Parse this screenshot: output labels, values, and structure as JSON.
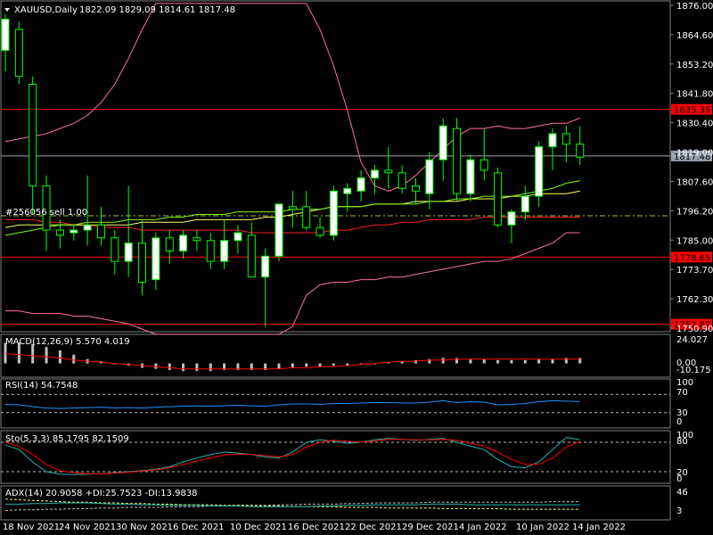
{
  "chart_data": {
    "type": "candlestick",
    "symbol_label": "XAUUSD,Daily",
    "ohlc_header": "1822.09 1829.09 1814.61 1817.48",
    "y_axis_ticks": [
      "1876.00",
      "1864.60",
      "1853.20",
      "1841.80",
      "1830.40",
      "1819.00",
      "1807.60",
      "1796.20",
      "1785.00",
      "1773.70",
      "1762.30",
      "1750.90"
    ],
    "x_axis_labels": [
      "18 Nov 2021",
      "24 Nov 2021",
      "30 Nov 2021",
      "6 Dec 2021",
      "10 Dec 2021",
      "16 Dec 2021",
      "22 Dec 2021",
      "29 Dec 2021",
      "4 Jan 2022",
      "10 Jan 2022",
      "14 Jan 2022"
    ],
    "ylim": [
      1750.0,
      1877.0
    ],
    "candles": [
      {
        "o": 1858,
        "h": 1872,
        "l": 1850,
        "c": 1870
      },
      {
        "o": 1866,
        "h": 1869,
        "l": 1845,
        "c": 1848
      },
      {
        "o": 1845,
        "h": 1848,
        "l": 1795,
        "c": 1806
      },
      {
        "o": 1806,
        "h": 1810,
        "l": 1781,
        "c": 1789
      },
      {
        "o": 1789,
        "h": 1793,
        "l": 1782,
        "c": 1787
      },
      {
        "o": 1788,
        "h": 1791,
        "l": 1785,
        "c": 1789
      },
      {
        "o": 1789,
        "h": 1810,
        "l": 1783,
        "c": 1791
      },
      {
        "o": 1791,
        "h": 1798,
        "l": 1783,
        "c": 1786
      },
      {
        "o": 1786,
        "h": 1789,
        "l": 1772,
        "c": 1777
      },
      {
        "o": 1777,
        "h": 1806,
        "l": 1771,
        "c": 1784
      },
      {
        "o": 1784,
        "h": 1793,
        "l": 1764,
        "c": 1769
      },
      {
        "o": 1770,
        "h": 1788,
        "l": 1766,
        "c": 1786
      },
      {
        "o": 1786,
        "h": 1789,
        "l": 1776,
        "c": 1781
      },
      {
        "o": 1781,
        "h": 1789,
        "l": 1778,
        "c": 1787
      },
      {
        "o": 1786,
        "h": 1789,
        "l": 1781,
        "c": 1785
      },
      {
        "o": 1785,
        "h": 1788,
        "l": 1774,
        "c": 1777
      },
      {
        "o": 1777,
        "h": 1793,
        "l": 1774,
        "c": 1785
      },
      {
        "o": 1785,
        "h": 1791,
        "l": 1780,
        "c": 1788
      },
      {
        "o": 1787,
        "h": 1792,
        "l": 1771,
        "c": 1771
      },
      {
        "o": 1771,
        "h": 1782,
        "l": 1752,
        "c": 1779
      },
      {
        "o": 1779,
        "h": 1799,
        "l": 1777,
        "c": 1799
      },
      {
        "o": 1798,
        "h": 1804,
        "l": 1790,
        "c": 1797
      },
      {
        "o": 1798,
        "h": 1804,
        "l": 1789,
        "c": 1790
      },
      {
        "o": 1790,
        "h": 1794,
        "l": 1786,
        "c": 1787
      },
      {
        "o": 1787,
        "h": 1806,
        "l": 1785,
        "c": 1804
      },
      {
        "o": 1803,
        "h": 1807,
        "l": 1796,
        "c": 1805
      },
      {
        "o": 1804,
        "h": 1812,
        "l": 1800,
        "c": 1809
      },
      {
        "o": 1809,
        "h": 1814,
        "l": 1803,
        "c": 1812
      },
      {
        "o": 1812,
        "h": 1821,
        "l": 1805,
        "c": 1811
      },
      {
        "o": 1811,
        "h": 1814,
        "l": 1803,
        "c": 1805
      },
      {
        "o": 1806,
        "h": 1809,
        "l": 1799,
        "c": 1804
      },
      {
        "o": 1803,
        "h": 1819,
        "l": 1797,
        "c": 1816
      },
      {
        "o": 1816,
        "h": 1832,
        "l": 1808,
        "c": 1829
      },
      {
        "o": 1828,
        "h": 1832,
        "l": 1800,
        "c": 1803
      },
      {
        "o": 1803,
        "h": 1818,
        "l": 1800,
        "c": 1816
      },
      {
        "o": 1816,
        "h": 1828,
        "l": 1808,
        "c": 1812
      },
      {
        "o": 1811,
        "h": 1813,
        "l": 1790,
        "c": 1791
      },
      {
        "o": 1791,
        "h": 1797,
        "l": 1784,
        "c": 1796
      },
      {
        "o": 1796,
        "h": 1806,
        "l": 1793,
        "c": 1802
      },
      {
        "o": 1802,
        "h": 1823,
        "l": 1798,
        "c": 1821
      },
      {
        "o": 1821,
        "h": 1828,
        "l": 1812,
        "c": 1826
      },
      {
        "o": 1826,
        "h": 1829,
        "l": 1815,
        "c": 1822
      },
      {
        "o": 1822,
        "h": 1829,
        "l": 1814,
        "c": 1817
      }
    ],
    "price_lines": [
      {
        "value": 1835.35,
        "label": "1835.35",
        "color": "#ff0000",
        "style": "solid"
      },
      {
        "value": 1817.48,
        "label": "1817.48",
        "color": "#9aa4b1",
        "style": "solid"
      },
      {
        "value": 1778.65,
        "label": "1778.65",
        "color": "#ff0000",
        "style": "solid"
      },
      {
        "value": 1752.87,
        "label": "1752.87",
        "color": "#ff0000",
        "style": "solid"
      },
      {
        "value": 1794.5,
        "label": "",
        "color": "#9acd32",
        "style": "dash-dot"
      }
    ],
    "order_label": "#256056 sell 1.00",
    "overlays": {
      "bb_upper": [
        1823,
        1824,
        1825,
        1826,
        1828,
        1830,
        1833,
        1838,
        1845,
        1855,
        1866,
        1876,
        1876,
        1876,
        1876,
        1876,
        1876,
        1876,
        1876,
        1876,
        1876,
        1876,
        1876,
        1866,
        1852,
        1835,
        1815,
        1806,
        1804,
        1806,
        1810,
        1815,
        1820,
        1825,
        1828,
        1828,
        1829,
        1828,
        1828,
        1829,
        1830,
        1830,
        1832
      ],
      "bb_lower": [
        1758,
        1758,
        1757,
        1757,
        1757,
        1756,
        1756,
        1755,
        1754,
        1753,
        1751,
        1749,
        1749,
        1749,
        1749,
        1749,
        1749,
        1749,
        1749,
        1749,
        1749,
        1752,
        1764,
        1768,
        1769,
        1769,
        1770,
        1770,
        1771,
        1771,
        1772,
        1773,
        1774,
        1775,
        1776,
        1777,
        1777,
        1778,
        1780,
        1782,
        1784,
        1788,
        1788
      ],
      "ma_green": [
        1787,
        1788,
        1789,
        1790,
        1791,
        1791,
        1792,
        1792,
        1792,
        1793,
        1793,
        1793,
        1794,
        1794,
        1795,
        1795,
        1795,
        1796,
        1796,
        1796,
        1796,
        1797,
        1797,
        1797,
        1798,
        1798,
        1798,
        1799,
        1799,
        1799,
        1799,
        1800,
        1800,
        1801,
        1801,
        1802,
        1802,
        1802,
        1803,
        1804,
        1805,
        1807,
        1808
      ],
      "ma_yellow": [
        1790,
        1791,
        1791,
        1791,
        1791,
        1791,
        1791,
        1791,
        1791,
        1791,
        1792,
        1792,
        1792,
        1792,
        1793,
        1793,
        1793,
        1793,
        1793,
        1794,
        1794,
        1795,
        1796,
        1797,
        1798,
        1798,
        1798,
        1799,
        1799,
        1799,
        1800,
        1800,
        1800,
        1800,
        1801,
        1801,
        1801,
        1802,
        1802,
        1803,
        1803,
        1803,
        1804
      ],
      "ma_red": [
        1793,
        1793,
        1793,
        1792,
        1792,
        1791,
        1791,
        1790,
        1790,
        1790,
        1789,
        1789,
        1789,
        1789,
        1789,
        1789,
        1789,
        1789,
        1788,
        1788,
        1788,
        1788,
        1788,
        1788,
        1789,
        1789,
        1790,
        1791,
        1791,
        1792,
        1792,
        1793,
        1793,
        1793,
        1793,
        1794,
        1794,
        1794,
        1794,
        1794,
        1794,
        1794,
        1794
      ]
    },
    "macd": {
      "label": "MACD(12,26,9) 5.570 4.019",
      "ticks": [
        "24.027",
        "0.00",
        "-10.175"
      ],
      "ylim": [
        -11,
        25
      ],
      "hist": [
        19,
        19,
        18,
        15,
        12,
        8,
        4,
        2,
        0,
        -2,
        -4,
        -5,
        -6,
        -7,
        -7,
        -7,
        -6,
        -6,
        -6,
        -6,
        -5,
        -4,
        -3,
        -3,
        -2,
        -2,
        -1,
        0,
        1,
        2,
        3,
        4,
        5,
        5,
        4,
        4,
        3,
        3,
        3,
        4,
        4,
        5,
        5
      ],
      "signal": [
        9,
        8,
        7,
        6,
        5,
        3,
        2,
        1,
        0,
        -1,
        -2,
        -3,
        -4,
        -5,
        -5,
        -5,
        -5,
        -5,
        -5,
        -5,
        -5,
        -4,
        -4,
        -3,
        -3,
        -2,
        -1,
        0,
        1,
        2,
        2,
        3,
        3,
        4,
        4,
        4,
        4,
        4,
        4,
        4,
        4,
        4,
        4
      ]
    },
    "rsi": {
      "label": "RSI(14) 54.7548",
      "ticks": [
        "100",
        "70",
        "30",
        "0"
      ],
      "levels": [
        70,
        30
      ],
      "values": [
        48,
        47,
        43,
        40,
        39,
        40,
        41,
        42,
        40,
        41,
        40,
        42,
        43,
        44,
        45,
        44,
        45,
        46,
        45,
        44,
        47,
        49,
        49,
        48,
        50,
        50,
        51,
        52,
        52,
        51,
        51,
        53,
        56,
        52,
        54,
        53,
        47,
        48,
        50,
        54,
        56,
        55,
        54
      ]
    },
    "stoch": {
      "label": "Sto(5,3,3) 85.1795 82.1509",
      "ticks": [
        "100",
        "80",
        "20",
        "0"
      ],
      "levels": [
        80,
        20
      ],
      "main": [
        75,
        65,
        40,
        20,
        15,
        14,
        15,
        16,
        18,
        20,
        22,
        25,
        30,
        40,
        48,
        55,
        60,
        58,
        55,
        50,
        48,
        60,
        80,
        85,
        82,
        78,
        80,
        85,
        88,
        86,
        84,
        86,
        88,
        80,
        72,
        65,
        45,
        30,
        28,
        40,
        65,
        90,
        85
      ],
      "signal": [
        80,
        72,
        55,
        35,
        22,
        18,
        16,
        16,
        17,
        19,
        21,
        24,
        28,
        35,
        42,
        48,
        54,
        56,
        55,
        53,
        50,
        55,
        70,
        80,
        84,
        82,
        80,
        83,
        86,
        86,
        85,
        85,
        86,
        84,
        78,
        72,
        60,
        45,
        35,
        35,
        48,
        70,
        82
      ]
    },
    "adx": {
      "label": "ADX(14) 20.9058 +DI:25.7523 -DI:13.9838",
      "ticks": [
        "46",
        "3"
      ],
      "ylim": [
        0,
        48
      ],
      "adx": [
        22,
        22,
        23,
        23,
        24,
        24,
        24,
        23,
        22,
        22,
        21,
        21,
        20,
        20,
        20,
        19,
        19,
        19,
        18,
        18,
        18,
        18,
        18,
        19,
        19,
        20,
        20,
        21,
        21,
        21,
        21,
        22,
        22,
        22,
        21,
        21,
        21,
        21,
        21,
        21,
        21,
        21,
        21
      ],
      "plus_di": [
        12,
        13,
        13,
        14,
        14,
        15,
        15,
        16,
        16,
        17,
        17,
        17,
        18,
        18,
        18,
        19,
        19,
        20,
        20,
        20,
        21,
        21,
        22,
        22,
        22,
        23,
        23,
        24,
        24,
        24,
        24,
        25,
        25,
        25,
        25,
        25,
        25,
        25,
        25,
        25,
        26,
        26,
        26
      ],
      "minus_di": [
        30,
        29,
        28,
        27,
        26,
        25,
        25,
        24,
        24,
        23,
        23,
        22,
        22,
        21,
        21,
        21,
        20,
        20,
        20,
        19,
        19,
        18,
        18,
        18,
        18,
        17,
        17,
        17,
        16,
        16,
        16,
        16,
        15,
        15,
        15,
        15,
        15,
        14,
        14,
        14,
        14,
        14,
        14
      ]
    }
  },
  "colors": {
    "background": "#000000",
    "grid_frame": "#7f7f7f",
    "bull_body": "#ffffff",
    "bear_body": "#000000",
    "candle_wick": "#00ff00",
    "bb_line": "#ff6fa0",
    "ma_green": "#7cfc00",
    "ma_yellow": "#ffff66",
    "ma_red": "#ff2020",
    "macd_hist": "#c0c0c0",
    "macd_signal": "#ff0000",
    "rsi_line": "#1e90ff",
    "stoch_main": "#20b2aa",
    "stoch_signal": "#ff0000",
    "adx_line": "#20b2aa",
    "plus_di": "#c0c0c0",
    "minus_di": "#ffff66",
    "current_price_tag": "#9aa4b1",
    "level_tag": "#ff0000"
  }
}
